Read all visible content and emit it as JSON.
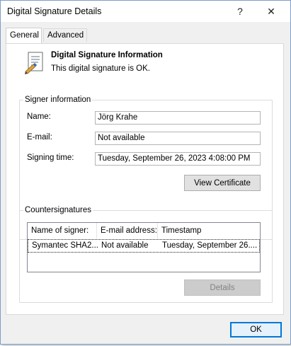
{
  "window": {
    "title": "Digital Signature Details"
  },
  "titlebar": {
    "help_label": "?",
    "close_label": "✕"
  },
  "tabs": [
    {
      "label": "General",
      "active": true
    },
    {
      "label": "Advanced",
      "active": false
    }
  ],
  "info": {
    "title": "Digital Signature Information",
    "status": "This digital signature is OK."
  },
  "signer": {
    "legend": "Signer information",
    "name_label": "Name:",
    "name_value": "Jörg Krahe",
    "email_label": "E-mail:",
    "email_value": "Not available",
    "time_label": "Signing time:",
    "time_value": "Tuesday, September 26, 2023 4:08:00 PM",
    "view_cert_label": "View Certificate"
  },
  "countersignatures": {
    "legend": "Countersignatures",
    "columns": [
      "Name of signer:",
      "E-mail address:",
      "Timestamp"
    ],
    "rows": [
      [
        "Symantec SHA2...",
        "Not available",
        "Tuesday, September 26...."
      ]
    ],
    "details_label": "Details"
  },
  "footer": {
    "ok_label": "OK"
  },
  "colors": {
    "accent": "#0078d7",
    "window_border": "#7a9ec9",
    "panel_bg": "#ffffff",
    "dialog_bg": "#f0f0f0"
  },
  "icons": {
    "certificate": "certificate-icon",
    "help": "help-icon",
    "close": "close-icon"
  }
}
